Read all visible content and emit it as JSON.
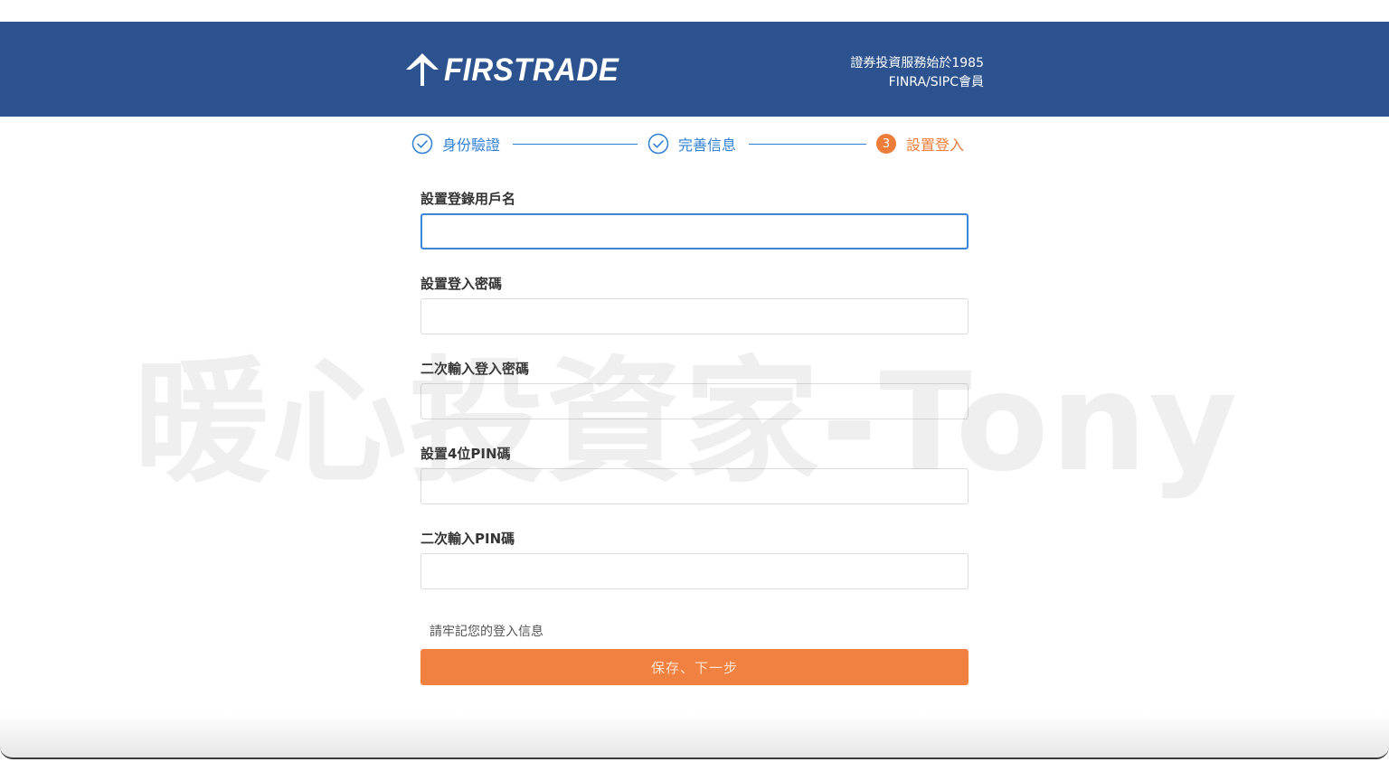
{
  "header": {
    "brand": "FIRSTRADE",
    "tagline_line1": "證券投資服務始於1985",
    "tagline_line2": "FINRA/SIPC會員",
    "background_color": "#2c538f"
  },
  "stepper": {
    "steps": [
      {
        "label": "身份驗證",
        "state": "done",
        "icon": "check-circle-icon"
      },
      {
        "label": "完善信息",
        "state": "done",
        "icon": "check-circle-icon"
      },
      {
        "label": "設置登入",
        "state": "active",
        "number": "3"
      }
    ],
    "done_color": "#2f7fd3",
    "active_color": "#ee7d3b"
  },
  "form": {
    "fields": [
      {
        "label": "設置登錄用戶名",
        "value": "",
        "placeholder": ""
      },
      {
        "label": "設置登入密碼",
        "value": "",
        "placeholder": ""
      },
      {
        "label": "二次輸入登入密碼",
        "value": "",
        "placeholder": ""
      },
      {
        "label": "設置4位PIN碼",
        "value": "",
        "placeholder": ""
      },
      {
        "label": "二次輸入PIN碼",
        "value": "",
        "placeholder": ""
      }
    ],
    "note": "請牢記您的登入信息",
    "submit_label": "保存、下一步",
    "submit_color": "#f08140"
  },
  "watermark": "暖心投資家-Tony"
}
